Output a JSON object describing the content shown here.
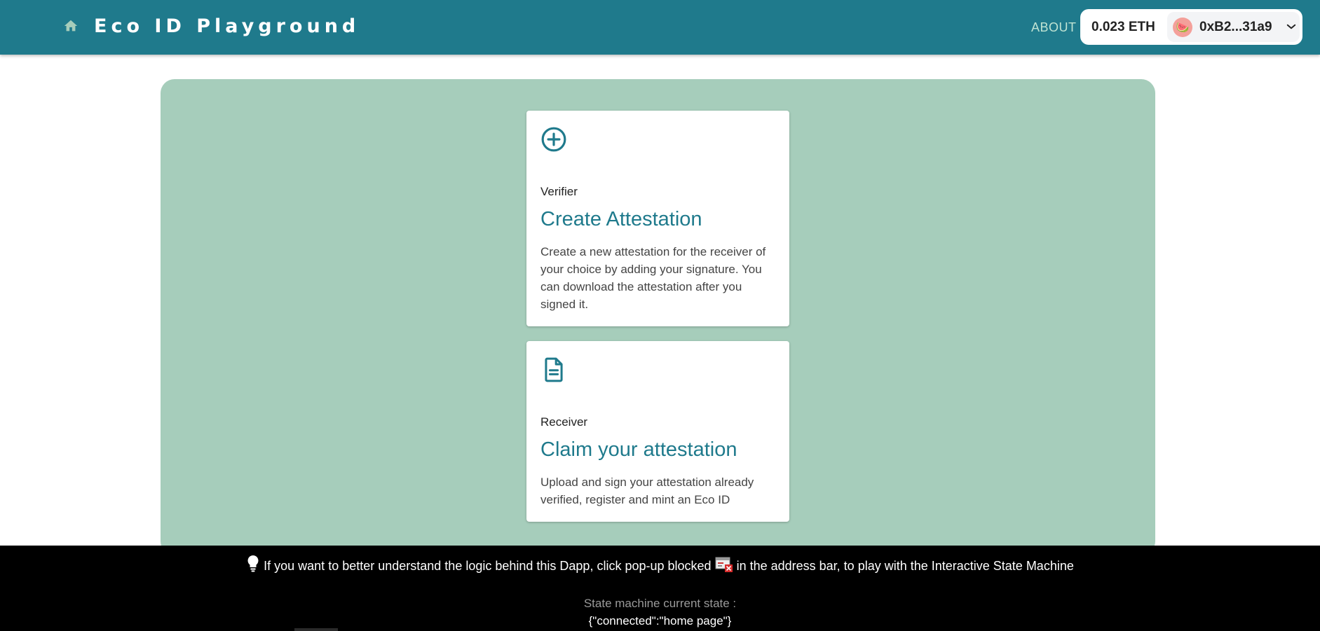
{
  "header": {
    "brand": "Eco ID Playground",
    "about_label": "ABOUT",
    "wallet": {
      "balance": "0.023 ETH",
      "address": "0xB2...31a9",
      "avatar_glyph": "🍉"
    },
    "bg_color": "#1f7a8c"
  },
  "cards": [
    {
      "icon": "add-circle-icon",
      "subtitle": "Verifier",
      "title": "Create Attestation",
      "description": "Create a new attestation for the receiver of your choice by adding your signature. You can download the attestation after you signed it."
    },
    {
      "icon": "document-icon",
      "subtitle": "Receiver",
      "title": "Claim your attestation",
      "description": "Upload and sign your attestation already verified, register and mint an Eco ID"
    }
  ],
  "footer": {
    "hint_part1": "If you want to better understand the logic behind this Dapp, click pop-up blocked",
    "hint_part2": "in the address bar, to play with the Interactive State Machine",
    "state_label": "State machine current state :",
    "state_value": "{\"connected\":\"home page\"}"
  },
  "colors": {
    "accent": "#1f7a8c",
    "panel_bg": "#a6cdbb",
    "footer_bg": "#000000"
  }
}
